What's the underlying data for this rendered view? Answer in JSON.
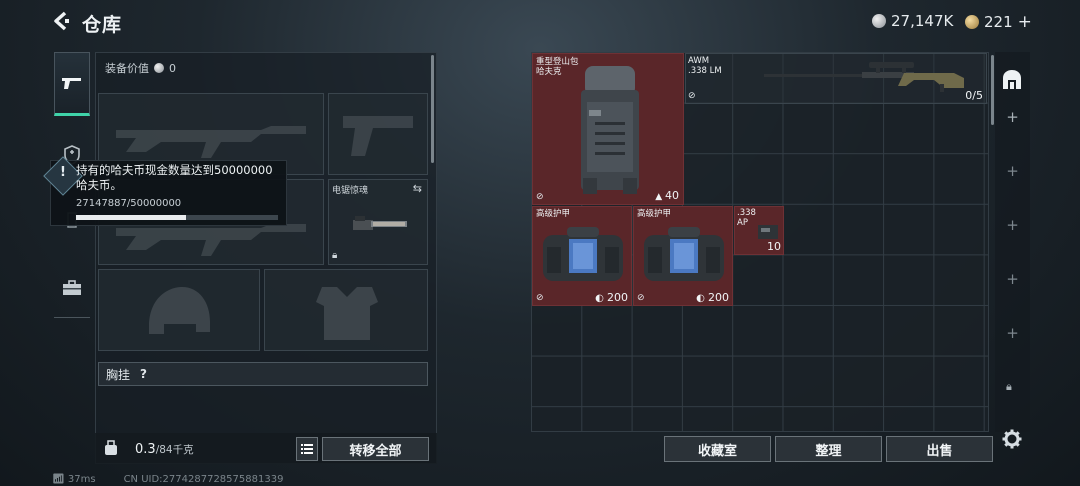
{
  "header": {
    "title": "仓库",
    "silver_amount": "27,147K",
    "gold_amount": "221",
    "gold_plus": "+"
  },
  "equipment": {
    "value_label": "装备价值",
    "value": "0",
    "melee_label": "电锯惊魂",
    "chest_label": "胸挂",
    "chest_help": "?"
  },
  "tooltip": {
    "message": "持有的哈夫币现金数量达到50000000哈夫币。",
    "progress_text": "27147887/50000000",
    "progress_fraction": 0.543
  },
  "weight": {
    "value": "0.3",
    "capacity": "/84千克",
    "transfer_all_label": "转移全部"
  },
  "storage": {
    "items": [
      {
        "name": "重型登山包\n哈夫克",
        "value": "40"
      },
      {
        "name": "AWM\n.338 LM",
        "value": "0/5"
      },
      {
        "name": "高级护甲",
        "value": "200"
      },
      {
        "name": "高级护甲",
        "value": "200"
      },
      {
        "name": ".338\nAP",
        "value": "10"
      }
    ]
  },
  "bottom_buttons": {
    "vault": "收藏室",
    "sort": "整理",
    "sell": "出售"
  },
  "status": {
    "ping": "37ms",
    "uid": "CN UID:2774287728575881339"
  }
}
